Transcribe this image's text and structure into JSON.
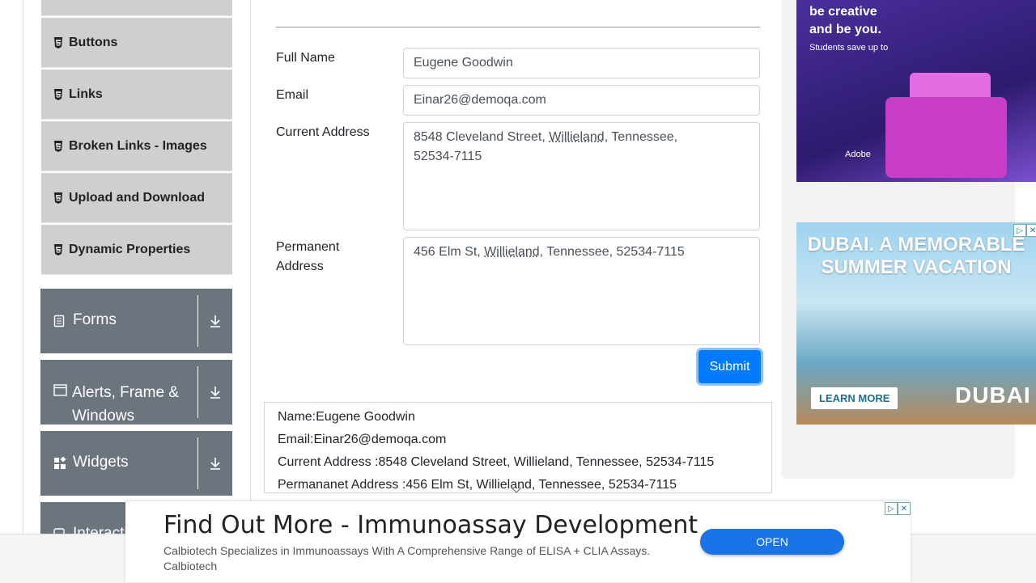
{
  "sidebar": {
    "elements_items": [
      {
        "label": "Buttons"
      },
      {
        "label": "Links"
      },
      {
        "label": "Broken Links - Images"
      },
      {
        "label": "Upload and Download"
      },
      {
        "label": "Dynamic Properties"
      }
    ],
    "groups": [
      {
        "label": "Forms",
        "icon": "form-icon"
      },
      {
        "label": "Alerts, Frame & Windows",
        "icon": "window-icon"
      },
      {
        "label": "Widgets",
        "icon": "widgets-icon"
      },
      {
        "label": "Interactions",
        "icon": "interactions-icon"
      }
    ]
  },
  "form": {
    "full_name_label": "Full Name",
    "full_name_value": "Eugene Goodwin",
    "email_label": "Email",
    "email_value": "Einar26@demoqa.com",
    "current_address_label": "Current Address",
    "current_address_line1_pre": "8548 Cleveland Street, ",
    "current_address_city": "Willieland",
    "current_address_line1_post": ", Tennessee,",
    "current_address_line2": "52534-7115",
    "permanent_address_label_1": "Permanent",
    "permanent_address_label_2": "Address",
    "permanent_address_pre": "456 Elm St, ",
    "permanent_address_city": "Willieland",
    "permanent_address_post": ", Tennessee, 52534-7115",
    "submit_label": "Submit"
  },
  "output": {
    "name": "Name:Eugene Goodwin",
    "email": "Email:Einar26@demoqa.com",
    "current_address": "Current Address :8548 Cleveland Street, Willieland, Tennessee, 52534-7115",
    "permanent_address": "Permananet Address :456 Elm St, Willieland, Tennessee, 52534-7115"
  },
  "ads": {
    "ad1_line1": "be creative",
    "ad1_line2": "and be you.",
    "ad1_line3": "Students save up to",
    "ad1_brand": "Adobe",
    "ad2_headline_1": "DUBAI. A MEMORABLE",
    "ad2_headline_2": "SUMMER VACATION",
    "ad2_cta": "LEARN MORE",
    "ad2_brand": "DUBAI",
    "bottom_title": "Find Out More - Immunoassay Development",
    "bottom_desc": "Calbiotech Specializes in Immunoassays With A Comprehensive Range of ELISA + CLIA Assays.",
    "bottom_advertiser": "Calbiotech",
    "bottom_button": "OPEN"
  },
  "colors": {
    "primary": "#007bff",
    "sidebar_group": "#6c757d",
    "sidebar_item": "#cfcfcf"
  }
}
